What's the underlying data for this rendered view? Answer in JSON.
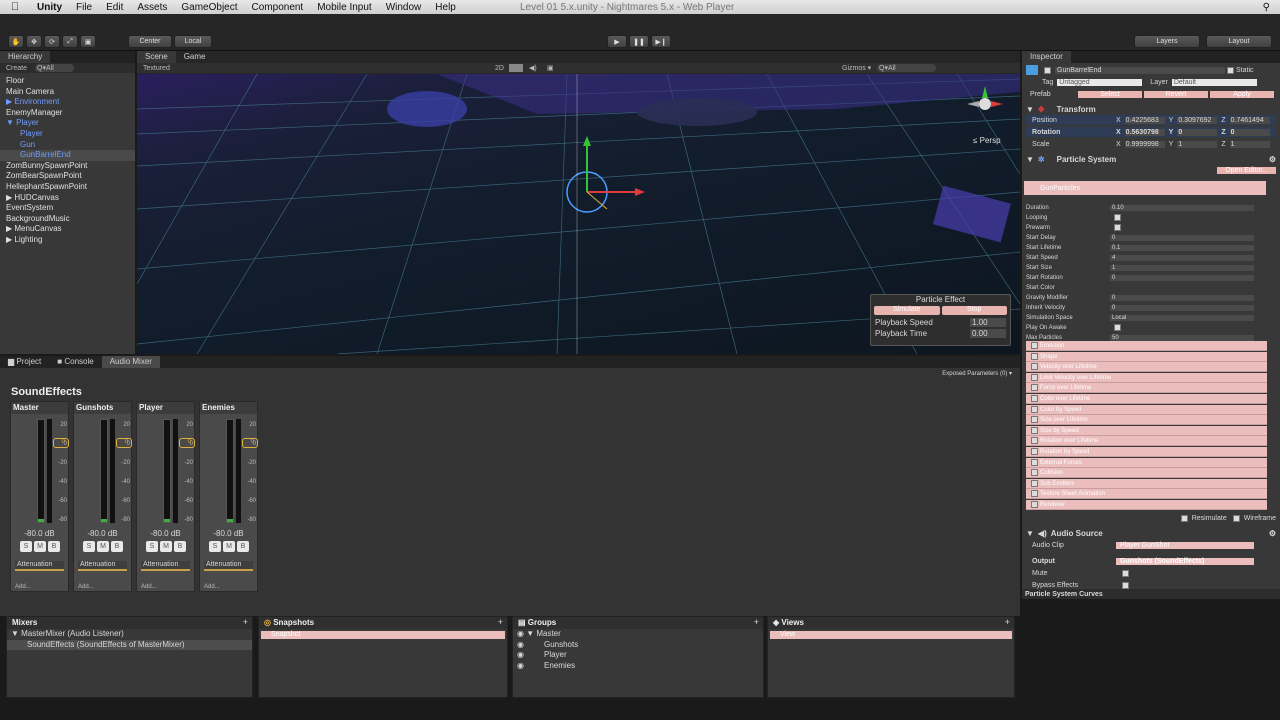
{
  "menubar": {
    "apple": "",
    "app": "Unity",
    "items": [
      "File",
      "Edit",
      "Assets",
      "GameObject",
      "Component",
      "Mobile Input",
      "Window",
      "Help"
    ],
    "window_title": "Level 01 5.x.unity - Nightmares 5.x - Web Player"
  },
  "toolbar": {
    "center": "Center",
    "local": "Local",
    "layers": "Layers",
    "layout": "Layout"
  },
  "hierarchy": {
    "tab": "Hierarchy",
    "create": "Create",
    "search": "Q▾All",
    "items": [
      {
        "t": "Floor",
        "c": ""
      },
      {
        "t": "Main Camera",
        "c": ""
      },
      {
        "t": "▶ Environment",
        "c": "blue"
      },
      {
        "t": "EnemyManager",
        "c": ""
      },
      {
        "t": "▼ Player",
        "c": "blue"
      },
      {
        "t": "Player",
        "c": "blue",
        "i": 1
      },
      {
        "t": "Gun",
        "c": "blue",
        "i": 1
      },
      {
        "t": "GunBarrelEnd",
        "c": "blue sel",
        "i": 1
      },
      {
        "t": "ZomBunnySpawnPoint",
        "c": ""
      },
      {
        "t": "ZomBearSpawnPoint",
        "c": ""
      },
      {
        "t": "HellephantSpawnPoint",
        "c": ""
      },
      {
        "t": "▶ HUDCanvas",
        "c": ""
      },
      {
        "t": "EventSystem",
        "c": ""
      },
      {
        "t": "BackgroundMusic",
        "c": ""
      },
      {
        "t": "▶ MenuCanvas",
        "c": ""
      },
      {
        "t": "▶ Lighting",
        "c": ""
      }
    ]
  },
  "scene": {
    "tab_scene": "Scene",
    "tab_game": "Game",
    "shading": "Textured",
    "mode2d": "2D",
    "gizmos": "Gizmos ▾",
    "gizmo_search": "Q▾All",
    "persp": "≤ Persp"
  },
  "particle_effect": {
    "title": "Particle Effect",
    "simulate": "Simulate",
    "stop": "Stop",
    "speed_label": "Playback Speed",
    "speed": "1.00",
    "time_label": "Playback Time",
    "time": "0.00"
  },
  "inspector": {
    "tab": "Inspector",
    "name": "GunBarrelEnd",
    "static": "Static",
    "tag_label": "Tag",
    "tag": "Untagged",
    "layer_label": "Layer",
    "layer": "Default",
    "prefab": "Prefab",
    "select": "Select",
    "revert": "Revert",
    "apply": "Apply",
    "transform": "Transform",
    "pos_label": "Position",
    "pos": [
      "0.4225683",
      "0.3097692",
      "0.7461494"
    ],
    "rot_label": "Rotation",
    "rot": [
      "0.5630798",
      "0",
      "0"
    ],
    "scale_label": "Scale",
    "scale": [
      "0.9999998",
      "1",
      "1"
    ],
    "ps": "Particle System",
    "open_editor": "Open Editor...",
    "ps_name": "GunParticles",
    "props": [
      [
        "Duration",
        "0.10"
      ],
      [
        "Looping",
        ""
      ],
      [
        "Prewarm",
        ""
      ],
      [
        "Start Delay",
        "0"
      ],
      [
        "Start Lifetime",
        "0.1"
      ],
      [
        "Start Speed",
        "4"
      ],
      [
        "Start Size",
        "1"
      ],
      [
        "Start Rotation",
        "0"
      ],
      [
        "Start Color",
        ""
      ],
      [
        "Gravity Modifier",
        "0"
      ],
      [
        "Inherit Velocity",
        "0"
      ],
      [
        "Simulation Space",
        "Local"
      ],
      [
        "Play On Awake",
        ""
      ],
      [
        "Max Particles",
        "50"
      ]
    ],
    "modules": [
      "Emission",
      "Shape",
      "Velocity over Lifetime",
      "Limit Velocity over Lifetime",
      "Force over Lifetime",
      "Color over Lifetime",
      "Color by Speed",
      "Size over Lifetime",
      "Size by Speed",
      "Rotation over Lifetime",
      "Rotation by Speed",
      "External Forces",
      "Collision",
      "Sub Emitters",
      "Texture Sheet Animation",
      "Renderer"
    ],
    "resimulate": "Resimulate",
    "wireframe": "Wireframe",
    "audio_source": "Audio Source",
    "audio_clip_label": "Audio Clip",
    "audio_clip": "Player GunShot",
    "output_label": "Output",
    "output": "Gunshots (SoundEffects)",
    "mute": "Mute",
    "bypass": "Bypass Effects",
    "curves": "Particle System Curves",
    "start_color": "#f5e020"
  },
  "bottom_tabs": {
    "project": "Project",
    "console": "Console",
    "mixer": "Audio Mixer"
  },
  "mixer": {
    "exposed": "Exposed Parameters (0) ▾",
    "title": "SoundEffects",
    "strips": [
      {
        "name": "Master",
        "db": "-80.0 dB"
      },
      {
        "name": "Gunshots",
        "db": "-80.0 dB"
      },
      {
        "name": "Player",
        "db": "-80.0 dB"
      },
      {
        "name": "Enemies",
        "db": "-80.0 dB"
      }
    ],
    "scale": [
      "20",
      "0",
      "-20",
      "-40",
      "-60",
      "-80"
    ],
    "knob": "0",
    "s": "S",
    "m": "M",
    "b": "B",
    "att": "Attenuation",
    "add": "Add..."
  },
  "mixers_panel": {
    "title": "Mixers",
    "items": [
      "▼ MasterMixer   (Audio Listener)",
      "SoundEffects   (SoundEffects of MasterMixer)"
    ]
  },
  "snapshots_panel": {
    "title": "Snapshots",
    "item": "Snapshot"
  },
  "groups_panel": {
    "title": "Groups",
    "items": [
      "Master",
      "Gunshots",
      "Player",
      "Enemies"
    ]
  },
  "views_panel": {
    "title": "Views",
    "item": "View"
  }
}
